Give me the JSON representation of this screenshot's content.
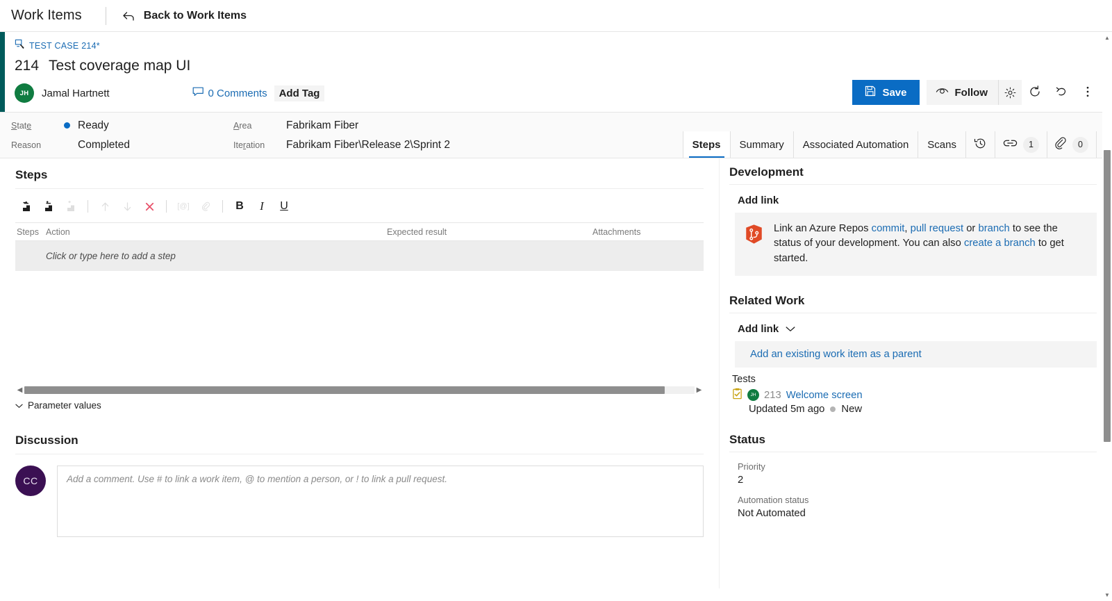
{
  "topbar": {
    "hub_title": "Work Items",
    "back_label": "Back to Work Items",
    "back_icon": "back-arrow-icon"
  },
  "work_item": {
    "type_label": "TEST CASE 214*",
    "type_icon": "test-case-icon",
    "id": "214",
    "title": "Test coverage map UI",
    "assigned_to": {
      "name": "Jamal Hartnett",
      "initials": "JH",
      "avatar_color": "#107c41"
    },
    "comments_label": "0 Comments",
    "comments_icon": "comment-bubble-icon",
    "add_tag_label": "Add Tag",
    "accent_color": "#005b5b"
  },
  "toolbar": {
    "save_label": "Save",
    "save_icon": "save-disk-icon",
    "save_color": "#0a6cc4",
    "follow_label": "Follow",
    "follow_icon": "eye-icon",
    "gear_icon": "gear-icon",
    "refresh_icon": "refresh-icon",
    "revert_icon": "undo-arrow-icon",
    "more_icon": "more-vertical-icon"
  },
  "fields": {
    "left": [
      {
        "label": "State",
        "value": "Ready",
        "has_dot": true,
        "dot_color": "#0a6cc4"
      },
      {
        "label": "Reason",
        "value": "Completed",
        "has_dot": false
      }
    ],
    "right": [
      {
        "label": "Area",
        "value": "Fabrikam Fiber"
      },
      {
        "label": "Iteration",
        "value": "Fabrikam Fiber\\Release 2\\Sprint 2"
      }
    ]
  },
  "tabs": [
    {
      "label": "Steps",
      "active": true,
      "kind": "text"
    },
    {
      "label": "Summary",
      "active": false,
      "kind": "text"
    },
    {
      "label": "Associated Automation",
      "active": false,
      "kind": "text"
    },
    {
      "label": "Scans",
      "active": false,
      "kind": "text"
    },
    {
      "label": "",
      "active": false,
      "kind": "icon",
      "icon": "history-clock-icon"
    },
    {
      "label": "",
      "active": false,
      "kind": "icon",
      "icon": "link-chain-icon",
      "badge": "1"
    },
    {
      "label": "",
      "active": false,
      "kind": "icon",
      "icon": "paperclip-icon",
      "badge": "0"
    }
  ],
  "steps": {
    "heading": "Steps",
    "toolbar_buttons": [
      {
        "name": "insert-step-icon",
        "disabled": false
      },
      {
        "name": "insert-shared-step-icon",
        "disabled": false
      },
      {
        "name": "create-shared-step-icon",
        "disabled": true
      },
      {
        "name": "move-up-icon",
        "disabled": true
      },
      {
        "name": "move-down-icon",
        "disabled": true
      },
      {
        "name": "delete-step-icon",
        "disabled": false
      },
      {
        "name": "insert-parameter-icon",
        "disabled": true
      },
      {
        "name": "attach-file-icon",
        "disabled": true
      },
      {
        "name": "bold-icon",
        "label": "B"
      },
      {
        "name": "italic-icon",
        "label": "I"
      },
      {
        "name": "underline-icon",
        "label": "U"
      }
    ],
    "columns": {
      "steps": "Steps",
      "action": "Action",
      "expected": "Expected result",
      "attachments": "Attachments"
    },
    "add_row_placeholder": "Click or type here to add a step",
    "parameter_values_label": "Parameter values"
  },
  "discussion": {
    "heading": "Discussion",
    "avatar_initials": "CC",
    "avatar_color": "#3b1053",
    "comment_placeholder": "Add a comment. Use # to link a work item, @ to mention a person, or ! to link a pull request."
  },
  "development": {
    "heading": "Development",
    "add_link_label": "Add link",
    "icon": "azure-repos-icon",
    "callout": {
      "part1": "Link an Azure Repos ",
      "link1": "commit",
      "part2": ", ",
      "link2": "pull request",
      "part3": " or ",
      "link3": "branch",
      "part4": " to see the status of your development. You can also ",
      "link4": "create a branch",
      "part5": " to get started."
    }
  },
  "related_work": {
    "heading": "Related Work",
    "add_link_label": "Add link",
    "chevron_icon": "chevron-down-icon",
    "add_parent_label": "Add an existing work item as a parent",
    "group_label": "Tests",
    "item": {
      "type_icon": "test-case-clipboard-icon",
      "avatar_initials": "JH",
      "avatar_color": "#107c41",
      "id": "213",
      "title": "Welcome screen",
      "updated": "Updated 5m ago",
      "state": "New",
      "state_dot_color": "#b4b4b4"
    }
  },
  "status": {
    "heading": "Status",
    "fields": [
      {
        "label": "Priority",
        "value": "2"
      },
      {
        "label": "Automation status",
        "value": "Not Automated"
      }
    ]
  }
}
